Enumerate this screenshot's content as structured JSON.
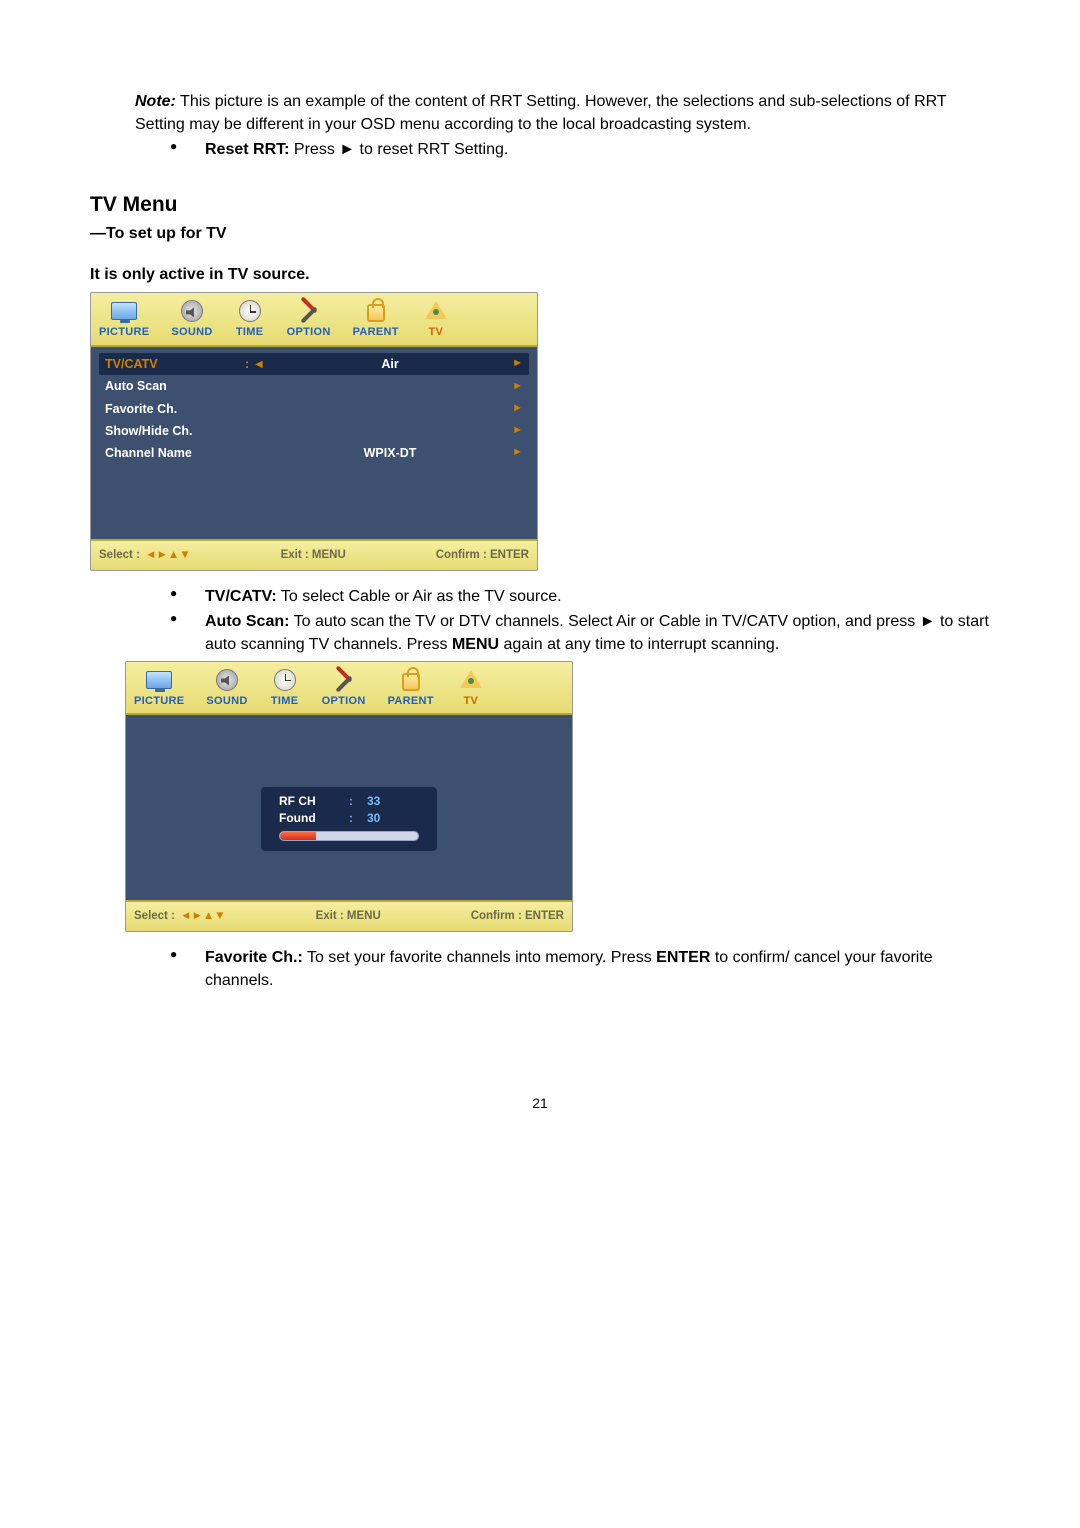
{
  "note": {
    "label": "Note:",
    "text_part1": " This picture is an example of the content of RRT Setting. However, the selections and sub-selections of RRT Setting may be different in your OSD menu according to the local broadcasting system."
  },
  "reset_rrt": {
    "label": "Reset RRT:",
    "text": " Press ► to reset RRT Setting."
  },
  "section": {
    "title": "TV Menu",
    "subtitle": "—To set up for TV",
    "active_note": "It is only active in TV source."
  },
  "osd_tabs": {
    "picture": "PICTURE",
    "sound": "SOUND",
    "time": "TIME",
    "option": "OPTION",
    "parent": "PARENT",
    "tv": "TV"
  },
  "osd1": {
    "rows": [
      {
        "label": "TV/CATV",
        "mid": ": ◄",
        "val": "Air",
        "arrow": "►",
        "selected": true
      },
      {
        "label": "Auto Scan",
        "mid": "",
        "val": "",
        "arrow": "►",
        "selected": false
      },
      {
        "label": "Favorite Ch.",
        "mid": "",
        "val": "",
        "arrow": "►",
        "selected": false
      },
      {
        "label": "Show/Hide Ch.",
        "mid": "",
        "val": "",
        "arrow": "►",
        "selected": false
      },
      {
        "label": "Channel Name",
        "mid": "",
        "val": "WPIX-DT",
        "arrow": "►",
        "selected": false
      }
    ]
  },
  "osd_footer": {
    "select_label": "Select :",
    "select_arrows": " ◄►▲▼",
    "exit": "Exit : MENU",
    "confirm": "Confirm : ENTER"
  },
  "descs": {
    "tvcatv_label": "TV/CATV:",
    "tvcatv_text": " To select Cable or Air as the TV source.",
    "autoscan_label": "Auto Scan:",
    "autoscan_text_l1": " To auto scan the TV or DTV channels. Select Air or Cable in TV/CATV option, and press ► to start auto scanning TV channels. Press ",
    "autoscan_menu": "MENU",
    "autoscan_text_l2": " again at any time to interrupt scanning."
  },
  "scan": {
    "rf_ch_label": "RF CH",
    "rf_ch_val": "33",
    "found_label": "Found",
    "found_val": "30"
  },
  "descs2": {
    "fav_label": "Favorite Ch.:",
    "fav_text_a": " To set your favorite channels into memory. Press ",
    "fav_enter": "ENTER",
    "fav_text_b": " to confirm/ cancel your favorite channels."
  },
  "page_number": "21"
}
